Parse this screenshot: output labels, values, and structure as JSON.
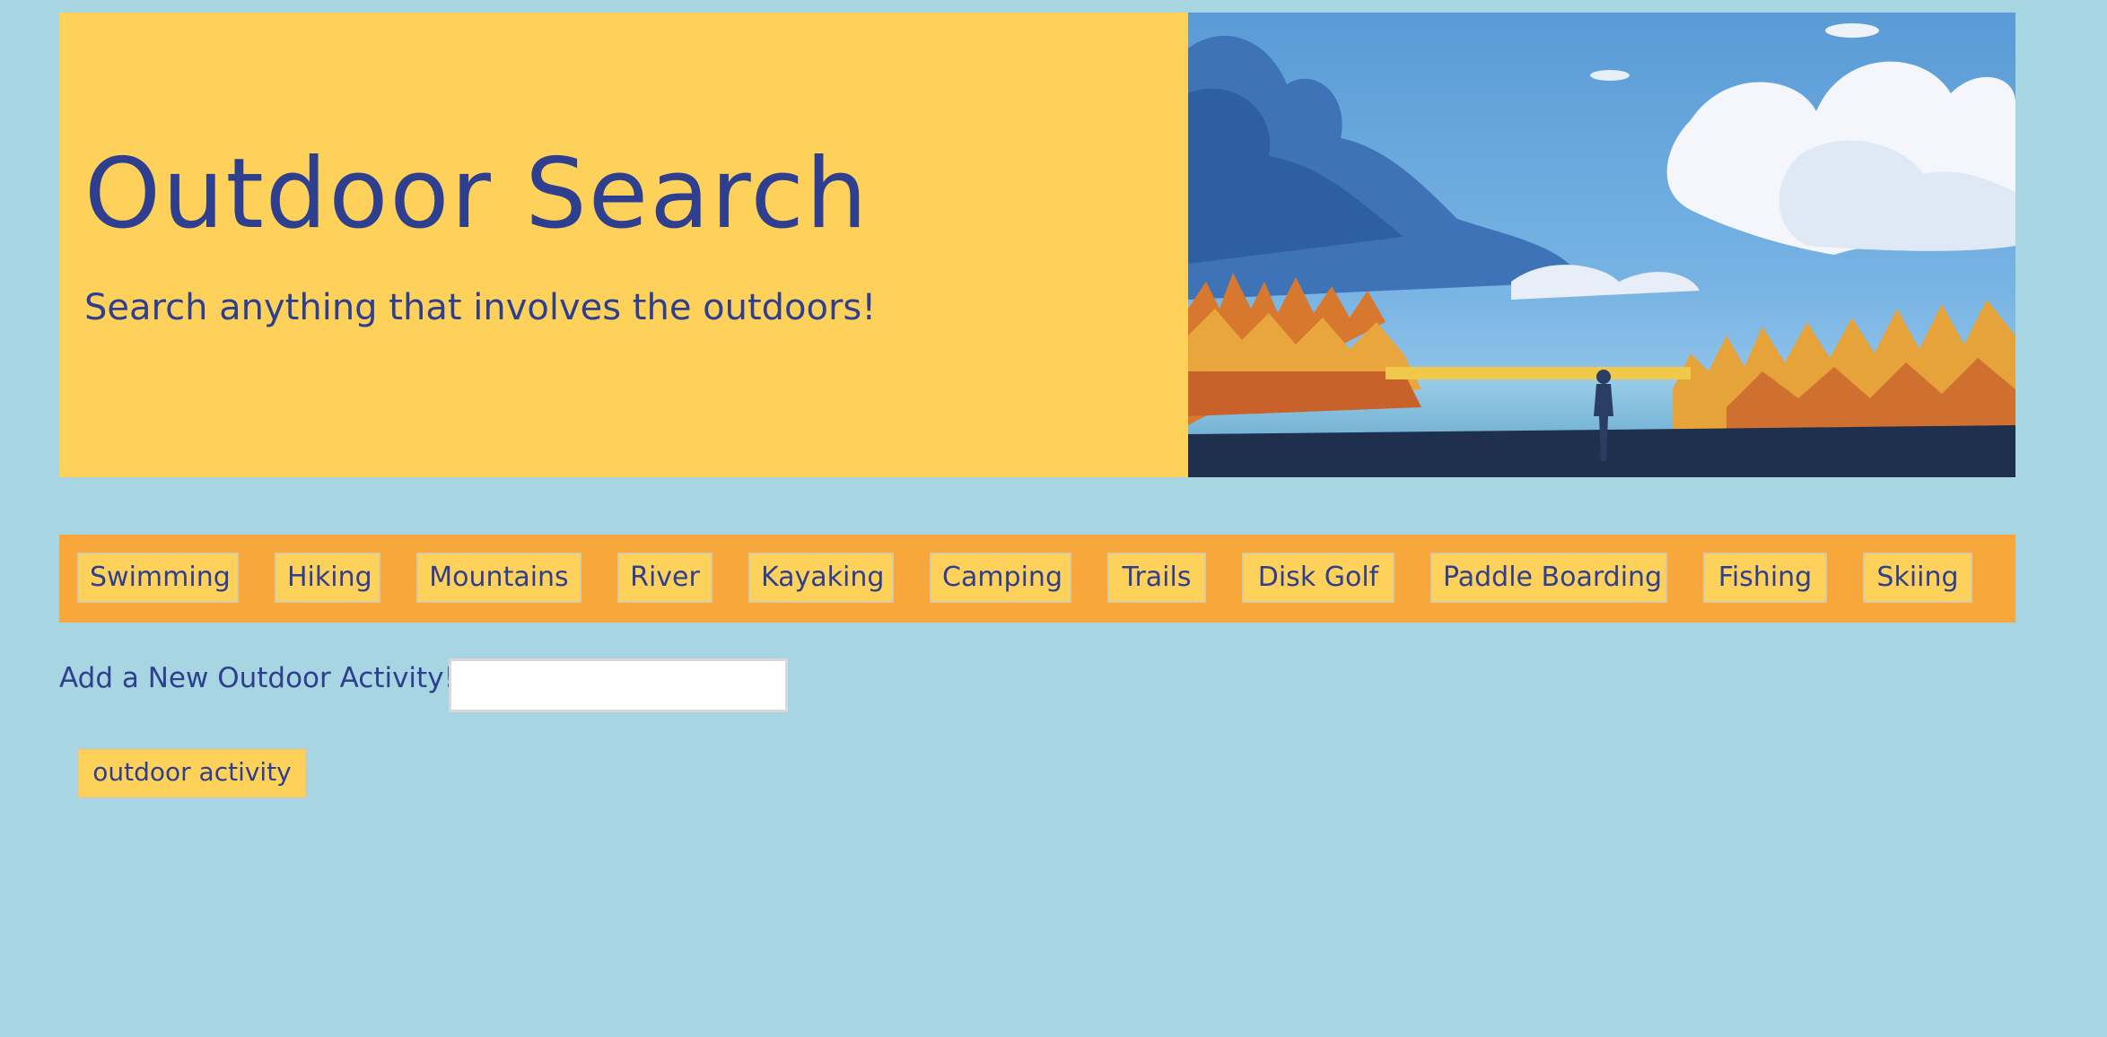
{
  "hero": {
    "title": "Outdoor Search",
    "subtitle": "Search anything that involves the outdoors!",
    "image_icon": "landscape-illustration"
  },
  "nav": {
    "items": [
      {
        "label": "Swimming"
      },
      {
        "label": "Hiking"
      },
      {
        "label": "Mountains"
      },
      {
        "label": "River"
      },
      {
        "label": "Kayaking"
      },
      {
        "label": "Camping"
      },
      {
        "label": "Trails"
      },
      {
        "label": "Disk Golf"
      },
      {
        "label": "Paddle Boarding"
      },
      {
        "label": "Fishing"
      },
      {
        "label": "Skiing"
      }
    ]
  },
  "add_form": {
    "label": "Add a New Outdoor Activity!",
    "input_value": "",
    "submit_label": "outdoor activity"
  },
  "colors": {
    "page_background": "#a8d5e2",
    "hero_background": "#fed25a",
    "nav_background": "#f8a73a",
    "button_background": "#fed25a",
    "text": "#2e3f8f"
  }
}
